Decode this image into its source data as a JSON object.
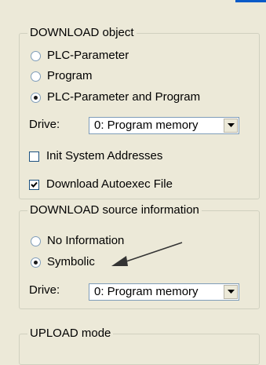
{
  "download_object": {
    "legend": "DOWNLOAD object",
    "options": [
      {
        "label": "PLC-Parameter",
        "checked": false
      },
      {
        "label": "Program",
        "checked": false
      },
      {
        "label": "PLC-Parameter and Program",
        "checked": true
      }
    ],
    "drive_label": "Drive:",
    "drive_value": "0: Program memory",
    "init_label": "Init System Addresses",
    "init_checked": false,
    "autoexec_label": "Download Autoexec File",
    "autoexec_checked": true
  },
  "download_source": {
    "legend": "DOWNLOAD source information",
    "options": [
      {
        "label": "No Information",
        "checked": false
      },
      {
        "label": "Symbolic",
        "checked": true
      }
    ],
    "drive_label": "Drive:",
    "drive_value": "0: Program memory"
  },
  "upload_mode": {
    "legend": "UPLOAD mode"
  },
  "colors": {
    "background": "#ece9d8",
    "group_border": "#d0d0bf",
    "radio_border": "#7f9db9",
    "title_strip": "#0a5bc8"
  },
  "icons": {
    "dropdown": "chevron-down-icon",
    "annotation": "arrow-icon",
    "checkmark": "checkmark-icon"
  }
}
